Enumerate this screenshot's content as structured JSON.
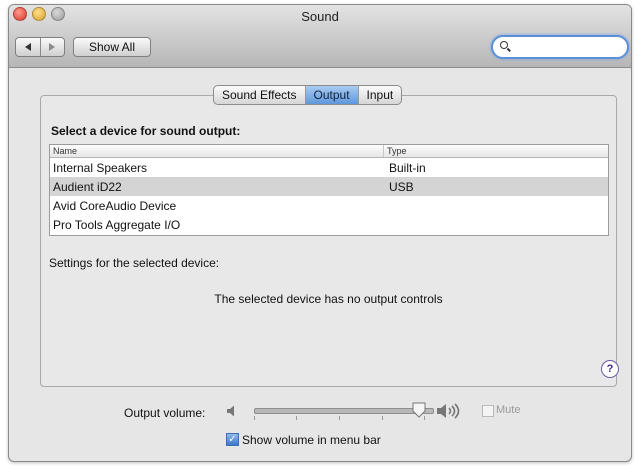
{
  "window": {
    "title": "Sound",
    "show_all_label": "Show All",
    "search": {
      "value": "",
      "placeholder": ""
    }
  },
  "tabs": [
    {
      "label": "Sound Effects",
      "active": false
    },
    {
      "label": "Output",
      "active": true
    },
    {
      "label": "Input",
      "active": false
    }
  ],
  "output": {
    "select_label": "Select a device for sound output:",
    "columns": [
      "Name",
      "Type"
    ],
    "devices": [
      {
        "name": "Internal Speakers",
        "type": "Built-in",
        "selected": false
      },
      {
        "name": "Audient iD22",
        "type": "USB",
        "selected": true
      },
      {
        "name": "Avid CoreAudio Device",
        "type": "",
        "selected": false
      },
      {
        "name": "Pro Tools Aggregate I/O",
        "type": "",
        "selected": false
      }
    ],
    "settings_label": "Settings for the selected device:",
    "no_controls_message": "The selected device has no output controls",
    "help_label": "?"
  },
  "volume": {
    "label": "Output volume:",
    "level_fraction": 0.95,
    "mute_label": "Mute",
    "mute_checked": false,
    "mute_enabled": false,
    "menu_bar_label": "Show volume in menu bar",
    "menu_bar_checked": true
  },
  "icons": {
    "back": "arrow-left-icon",
    "forward": "arrow-right-icon",
    "search": "search-icon",
    "volume_low": "speaker-low-icon",
    "volume_high": "speaker-high-icon",
    "help": "help-icon"
  },
  "colors": {
    "accent": "#5f98dc",
    "window_bg": "#e6e6e6",
    "selected_row": "#d4d4d4"
  }
}
